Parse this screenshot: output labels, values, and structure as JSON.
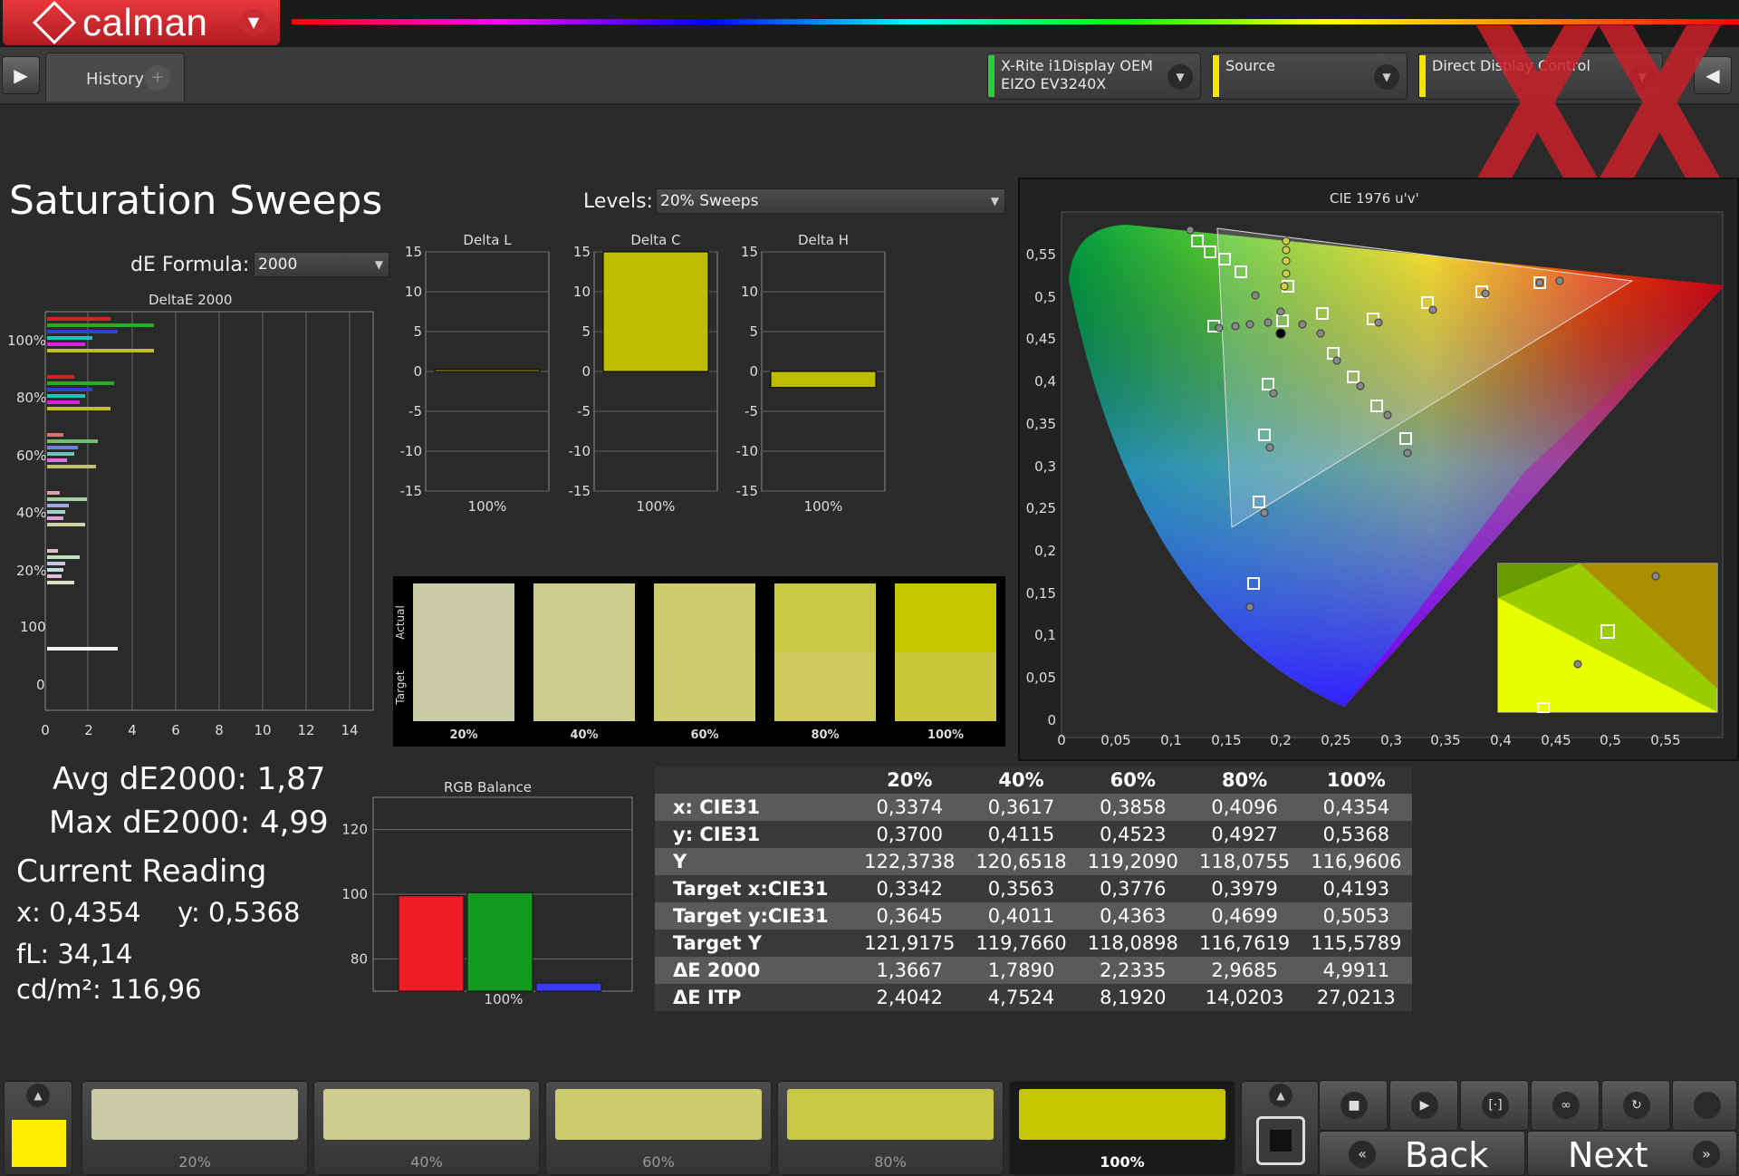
{
  "app": {
    "name": "calman"
  },
  "tabs": [
    {
      "label": "History 1"
    }
  ],
  "devices": [
    {
      "line1": "X-Rite i1Display OEM",
      "line2": "EIZO EV3240X",
      "color": "#2ecc40"
    },
    {
      "line1": "Source",
      "line2": "",
      "color": "#f4e500"
    },
    {
      "line1": "Direct Display Control",
      "line2": "",
      "color": "#f4e500"
    }
  ],
  "page": {
    "title": "Saturation Sweeps"
  },
  "levels": {
    "label": "Levels:",
    "value": "20% Sweeps"
  },
  "formula": {
    "label": "dE Formula:",
    "value": "2000"
  },
  "deltae_chart": {
    "title": "DeltaE 2000",
    "xticks": [
      "0",
      "2",
      "4",
      "6",
      "8",
      "10",
      "12",
      "14"
    ],
    "yticks": [
      "100%",
      "80%",
      "60%",
      "40%",
      "20%",
      "100",
      "0"
    ]
  },
  "delta_charts": [
    {
      "title": "Delta L",
      "value": 0.2,
      "label": "100%",
      "color": "#b8a818"
    },
    {
      "title": "Delta C",
      "value": 15,
      "label": "100%",
      "color": "#bdbc00"
    },
    {
      "title": "Delta H",
      "value": -2,
      "label": "100%",
      "color": "#bdbc00"
    }
  ],
  "delta_yticks": [
    "15",
    "10",
    "5",
    "0",
    "-5",
    "-10",
    "-15"
  ],
  "swatch_panel": {
    "actual_label": "Actual",
    "target_label": "Target",
    "items": [
      {
        "label": "20%",
        "actual": "#cbcaa6",
        "target": "#cbcaa6"
      },
      {
        "label": "40%",
        "actual": "#cdcc8c",
        "target": "#cdcc8c"
      },
      {
        "label": "60%",
        "actual": "#cdcc6c",
        "target": "#ceca70"
      },
      {
        "label": "80%",
        "actual": "#c9c845",
        "target": "#cfc85a"
      },
      {
        "label": "100%",
        "actual": "#c6c600",
        "target": "#cbc53c"
      }
    ]
  },
  "cie": {
    "title": "CIE 1976 u'v'",
    "xticks": [
      "0",
      "0,05",
      "0,1",
      "0,15",
      "0,2",
      "0,25",
      "0,3",
      "0,35",
      "0,4",
      "0,45",
      "0,5",
      "0,55"
    ],
    "yticks": [
      "0,55",
      "0,5",
      "0,45",
      "0,4",
      "0,35",
      "0,3",
      "0,25",
      "0,2",
      "0,15",
      "0,1",
      "0,05",
      "0"
    ]
  },
  "stats": {
    "avg": "Avg dE2000: 1,87",
    "max": "Max dE2000: 4,99",
    "current_heading": "Current Reading",
    "x": "x: 0,4354",
    "y": "y: 0,5368",
    "fl": "fL: 34,14",
    "cdm2": "cd/m²: 116,96"
  },
  "rgb_balance": {
    "title": "RGB Balance",
    "yticks": [
      "120",
      "100",
      "80"
    ],
    "label": "100%",
    "chart_data": {
      "type": "bar",
      "categories": [
        "R",
        "G",
        "B"
      ],
      "values": [
        99.5,
        100.5,
        72.5
      ],
      "ylim": [
        70,
        130
      ]
    }
  },
  "table": {
    "headers": [
      "",
      "20%",
      "40%",
      "60%",
      "80%",
      "100%"
    ],
    "rows": [
      {
        "label": "x: CIE31",
        "values": [
          "0,3374",
          "0,3617",
          "0,3858",
          "0,4096",
          "0,4354"
        ]
      },
      {
        "label": "y: CIE31",
        "values": [
          "0,3700",
          "0,4115",
          "0,4523",
          "0,4927",
          "0,5368"
        ]
      },
      {
        "label": "Y",
        "values": [
          "122,3738",
          "120,6518",
          "119,2090",
          "118,0755",
          "116,9606"
        ]
      },
      {
        "label": "Target x:CIE31",
        "values": [
          "0,3342",
          "0,3563",
          "0,3776",
          "0,3979",
          "0,4193"
        ]
      },
      {
        "label": "Target y:CIE31",
        "values": [
          "0,3645",
          "0,4011",
          "0,4363",
          "0,4699",
          "0,5053"
        ]
      },
      {
        "label": "Target Y",
        "values": [
          "121,9175",
          "119,7660",
          "118,0898",
          "116,7619",
          "115,5789"
        ]
      },
      {
        "label": "ΔE 2000",
        "values": [
          "1,3667",
          "1,7890",
          "2,2335",
          "2,9685",
          "4,9911"
        ]
      },
      {
        "label": "ΔE ITP",
        "values": [
          "2,4042",
          "4,7524",
          "8,1920",
          "14,0203",
          "27,0213"
        ]
      }
    ]
  },
  "bottom": {
    "current_color": "#ffee00",
    "swatches": [
      {
        "label": "20%",
        "color": "#cbcaa6"
      },
      {
        "label": "40%",
        "color": "#cdcc8c"
      },
      {
        "label": "60%",
        "color": "#cdcc6c"
      },
      {
        "label": "80%",
        "color": "#c9c845"
      },
      {
        "label": "100%",
        "color": "#c6c600"
      }
    ],
    "back": "Back",
    "next": "Next"
  }
}
